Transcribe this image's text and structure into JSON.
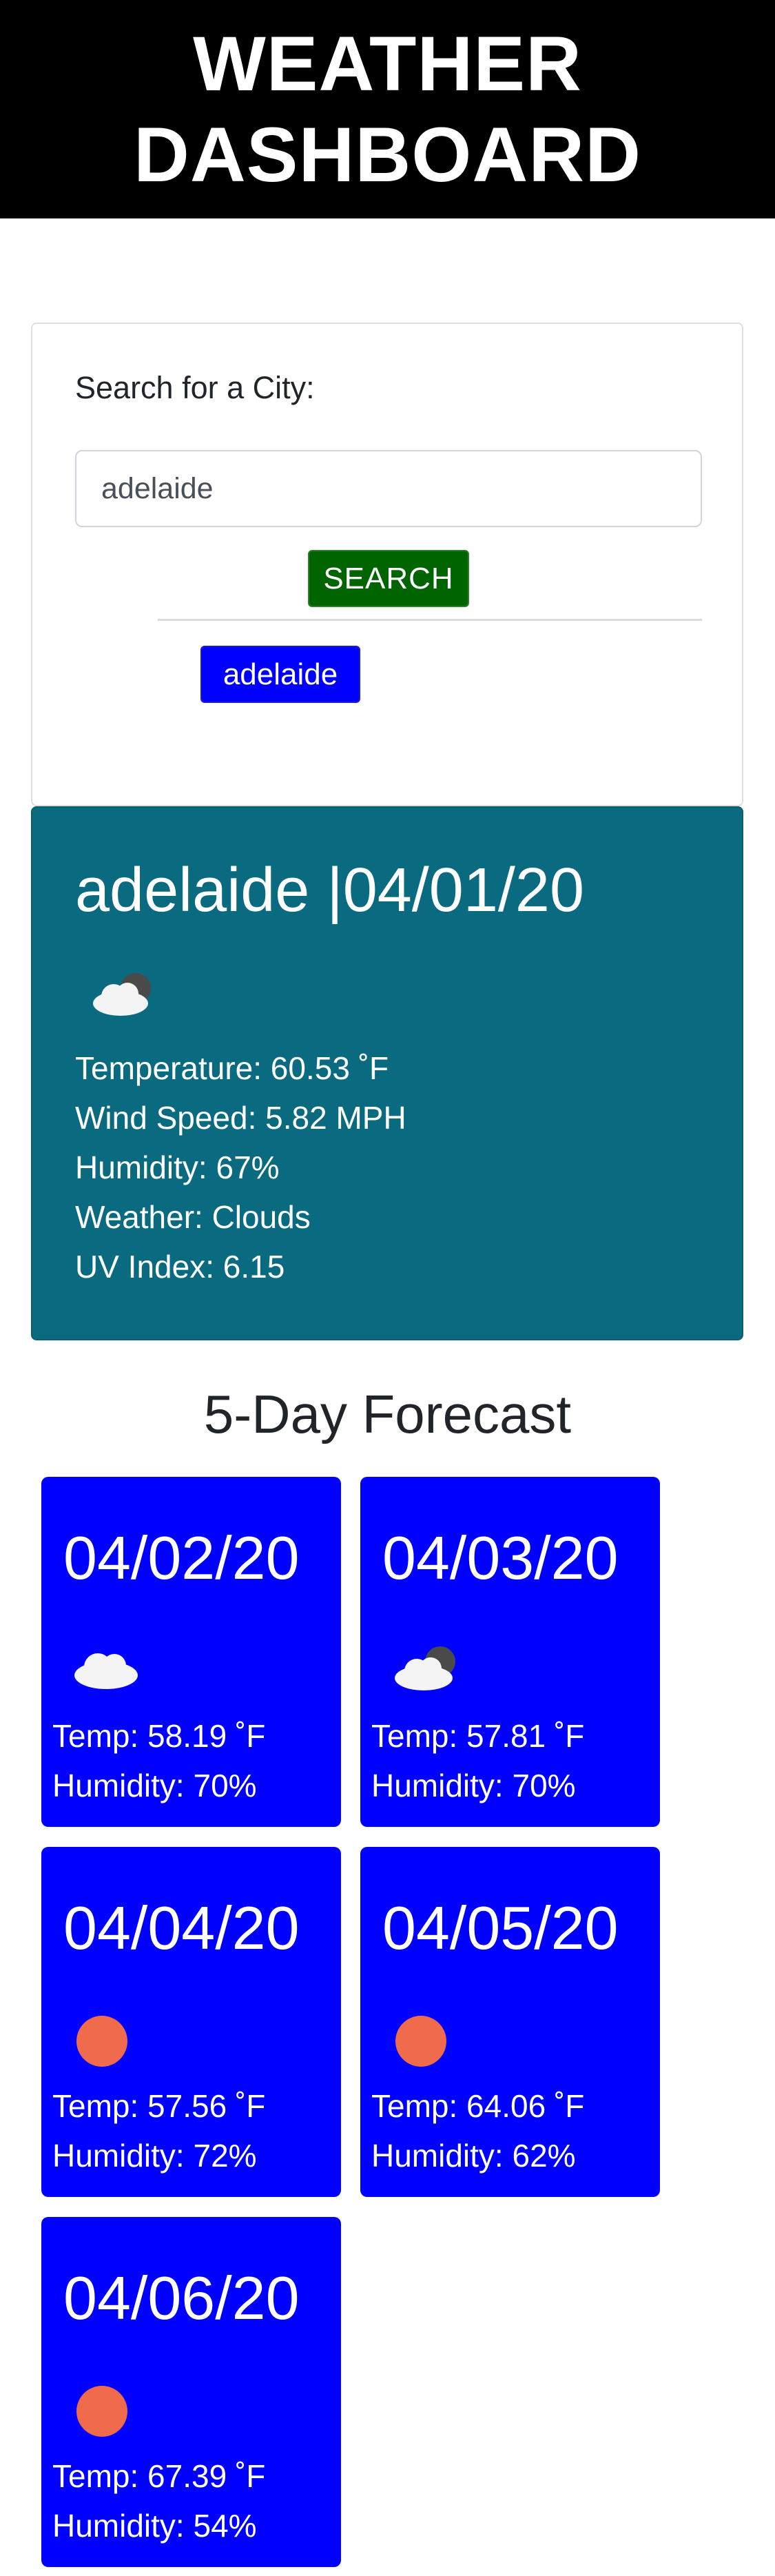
{
  "header": {
    "title_line1": "WEATHER",
    "title_line2": "DASHBOARD"
  },
  "search": {
    "label": "Search for a City:",
    "input_value": "adelaide",
    "button_label": "SEARCH",
    "history": [
      "adelaide"
    ]
  },
  "current": {
    "title": "adelaide |04/01/20",
    "icon": "cloud-partly-icon",
    "lines": {
      "temperature": "Temperature: 60.53 ˚F",
      "wind": "Wind Speed: 5.82 MPH",
      "humidity": "Humidity: 67%",
      "weather": "Weather: Clouds",
      "uv": "UV Index: 6.15"
    }
  },
  "forecast": {
    "heading": "5-Day Forecast",
    "days": [
      {
        "date": "04/02/20",
        "icon": "cloud-icon",
        "temp": "Temp: 58.19 ˚F",
        "humidity": "Humidity: 70%"
      },
      {
        "date": "04/03/20",
        "icon": "cloud-partly-icon",
        "temp": "Temp: 57.81 ˚F",
        "humidity": "Humidity: 70%"
      },
      {
        "date": "04/04/20",
        "icon": "sun-icon",
        "temp": "Temp: 57.56 ˚F",
        "humidity": "Humidity: 72%"
      },
      {
        "date": "04/05/20",
        "icon": "sun-icon",
        "temp": "Temp: 64.06 ˚F",
        "humidity": "Humidity: 62%"
      },
      {
        "date": "04/06/20",
        "icon": "sun-icon",
        "temp": "Temp: 67.39 ˚F",
        "humidity": "Humidity: 54%"
      }
    ]
  },
  "colors": {
    "header_bg": "#000000",
    "search_button": "#006400",
    "history_button": "#0000ff",
    "current_card": "#0a6b80",
    "forecast_card": "#0000ff",
    "sun": "#ef6b4c"
  }
}
